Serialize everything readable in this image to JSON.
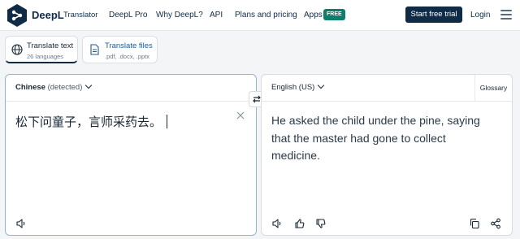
{
  "header": {
    "brand": "DeepL",
    "brand_sub": "Translator",
    "nav": [
      "DeepL Pro",
      "Why DeepL?",
      "API",
      "Plans and pricing",
      "Apps"
    ],
    "apps_badge": "FREE",
    "cta": "Start free trial",
    "login": "Login"
  },
  "tabs": [
    {
      "title": "Translate text",
      "subtitle": "26 languages"
    },
    {
      "title": "Translate files",
      "subtitle": ".pdf, .docx, .pptx"
    }
  ],
  "source": {
    "language": "Chinese",
    "detected": "(detected)",
    "text": "松下问童子，言师采药去。"
  },
  "target": {
    "language": "English (US)",
    "glossary": "Glossary",
    "text": "He asked the child under the pine, saying that the master had gone to collect medicine."
  },
  "icons": {
    "logo": "deepl-logo-icon",
    "globe": "globe-icon",
    "file": "document-icon",
    "swap": "swap-icon",
    "clear": "close-icon",
    "speaker": "speaker-icon",
    "like": "thumbs-up-icon",
    "dislike": "thumbs-down-icon",
    "copy": "copy-icon",
    "share": "share-icon",
    "menu": "hamburger-menu-icon"
  },
  "colors": {
    "brand_navy": "#0f2b46",
    "badge_green": "#0f7d6b",
    "active_border": "#8fb5dd"
  }
}
